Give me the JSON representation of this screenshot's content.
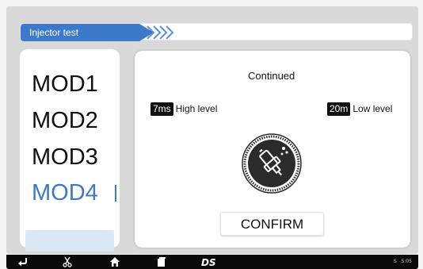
{
  "header": {
    "title": "Injector test"
  },
  "modes": {
    "items": [
      "MOD1",
      "MOD2",
      "MOD3",
      "MOD4"
    ],
    "selected": "MOD4"
  },
  "panel": {
    "mode_label": "Continued",
    "high": {
      "value": "7ms",
      "label": "High level"
    },
    "low": {
      "value": "20m",
      "label": "Low level"
    },
    "confirm_label": "CONFIRM"
  },
  "navbar": {
    "icons": [
      "back-icon",
      "scissors-icon",
      "home-icon",
      "recent-apps-icon",
      "ds-logo"
    ],
    "logo_text": "DS",
    "status_indicator": "S",
    "clock": "5:05"
  },
  "colors": {
    "accent": "#3d79c9",
    "selected_bg": "#dbe8f6",
    "navbar": "#0a0a0a"
  }
}
